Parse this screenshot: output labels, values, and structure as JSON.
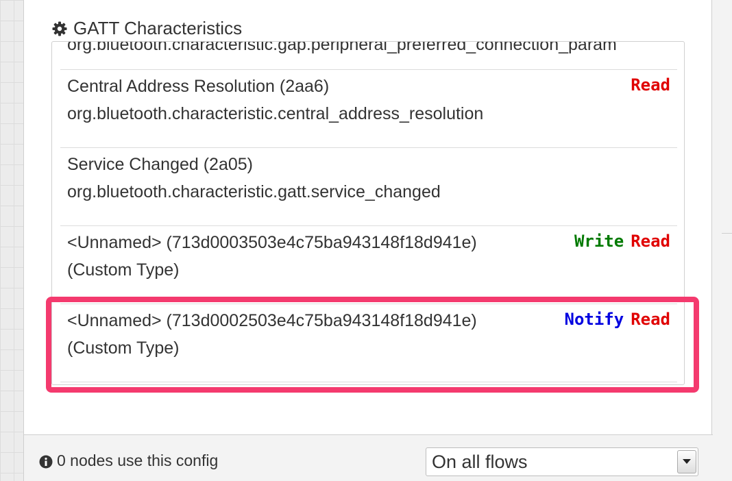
{
  "section": {
    "title": "GATT Characteristics",
    "icon": "gear-icon"
  },
  "characteristics": [
    {
      "name": "",
      "uuid_line": "org.bluetooth.characteristic.gap.peripheral_preferred_connection_param",
      "properties": []
    },
    {
      "name": "Central Address Resolution  (2aa6)",
      "uuid_line": "org.bluetooth.characteristic.central_address_resolution",
      "properties": [
        "Read"
      ]
    },
    {
      "name": "Service Changed  (2a05)",
      "uuid_line": "org.bluetooth.characteristic.gatt.service_changed",
      "properties": []
    },
    {
      "name": "<Unnamed>  (713d0003503e4c75ba943148f18d941e)",
      "uuid_line": "(Custom Type)",
      "properties": [
        "Write",
        "Read"
      ]
    },
    {
      "name": "<Unnamed>  (713d0002503e4c75ba943148f18d941e)",
      "uuid_line": "(Custom Type)",
      "properties": [
        "Notify",
        "Read"
      ],
      "highlighted": true
    }
  ],
  "footer": {
    "info_icon": "info-icon",
    "info_text": "0 nodes use this config",
    "scope_value": "On all flows"
  },
  "colors": {
    "read": "#e00000",
    "write": "#007a00",
    "notify": "#0000e0",
    "highlight": "#f43a6e"
  }
}
